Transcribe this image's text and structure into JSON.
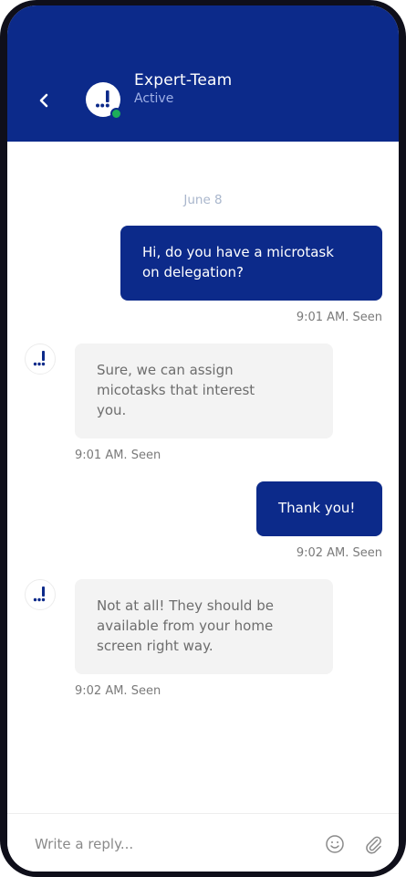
{
  "header": {
    "title": "Expert-Team",
    "status": "Active",
    "back_icon": "chevron-left-icon",
    "avatar_icon": "logo-icon",
    "status_color": "#1dae5a",
    "background": "#0c2a8a"
  },
  "conversation": {
    "date": "June 8",
    "messages": [
      {
        "direction": "sent",
        "text": "Hi, do you have a microtask\non delegation?",
        "meta": "9:01 AM. Seen"
      },
      {
        "direction": "received",
        "text": "Sure, we can assign\nmicotasks that interest\nyou.",
        "meta": "9:01 AM. Seen"
      },
      {
        "direction": "sent",
        "text": "Thank you!",
        "meta": "9:02 AM. Seen"
      },
      {
        "direction": "received",
        "text": "Not at all! They should be\navailable from your home\nscreen right way.",
        "meta": "9:02 AM. Seen"
      }
    ]
  },
  "composer": {
    "placeholder": "Write a reply...",
    "emoji_icon": "smiley-icon",
    "attach_icon": "paperclip-icon"
  },
  "colors": {
    "accent": "#0c2a8a",
    "received_bubble": "#f3f3f3",
    "online": "#1dae5a"
  }
}
